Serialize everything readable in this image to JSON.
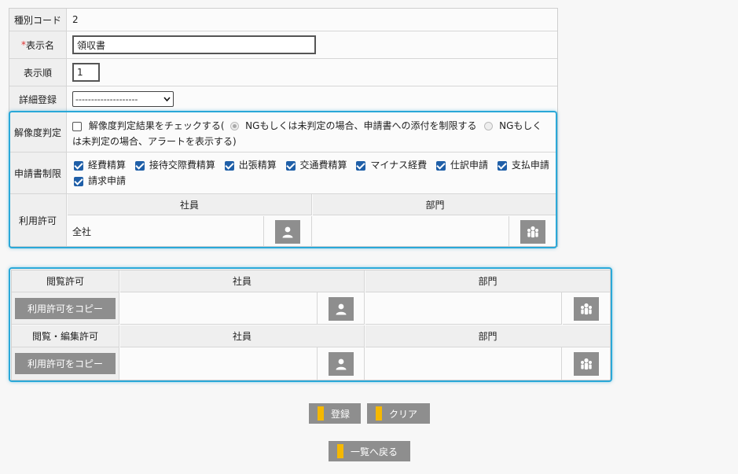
{
  "form": {
    "type_code_label": "種別コード",
    "type_code_value": "2",
    "display_name_required": "*",
    "display_name_label": "表示名",
    "display_name_value": "領収書",
    "display_order_label": "表示順",
    "display_order_value": "1",
    "detail_label": "詳細登録",
    "detail_value": "--------------------",
    "resolution_label": "解像度判定",
    "resolution_check_text": "解像度判定結果をチェックする(",
    "resolution_opt1": "NGもしくは未判定の場合、申請書への添付を制限する",
    "resolution_opt2_a": "NGもしく",
    "resolution_opt2_b": "は未判定の場合、アラートを表示する)",
    "restriction_label": "申請書制限",
    "restrictions": [
      "経費精算",
      "接待交際費精算",
      "出張精算",
      "交通費精算",
      "マイナス経費",
      "仕訳申請",
      "支払申請",
      "請求申請"
    ],
    "usage_label": "利用許可",
    "employee_header": "社員",
    "department_header": "部門",
    "usage_employee_value": "全社"
  },
  "permissions": {
    "view_label": "閲覧許可",
    "edit_label": "閲覧・編集許可",
    "employee_header": "社員",
    "department_header": "部門",
    "copy_button": "利用許可をコピー"
  },
  "actions": {
    "register": "登録",
    "clear": "クリア",
    "back": "一覧へ戻る"
  },
  "colors": {
    "highlight": "#2aa8d8",
    "button_gray": "#8e8e8e",
    "accent_yellow": "#f5b800",
    "checkbox_blue": "#1f5fa8"
  }
}
